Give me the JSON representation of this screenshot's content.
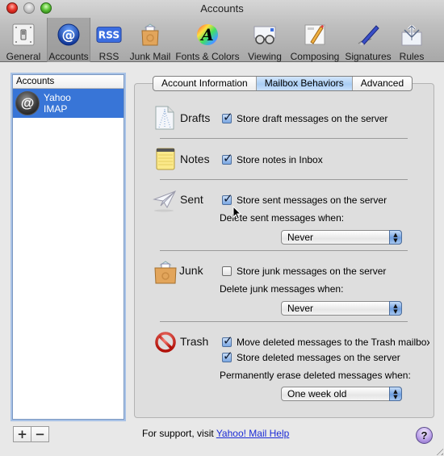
{
  "window": {
    "title": "Accounts"
  },
  "toolbar": {
    "items": [
      {
        "id": "general",
        "label": "General",
        "icon": "switch-icon",
        "selected": false
      },
      {
        "id": "accounts",
        "label": "Accounts",
        "icon": "at-sign-icon",
        "selected": true
      },
      {
        "id": "rss",
        "label": "RSS",
        "icon": "rss-icon",
        "selected": false
      },
      {
        "id": "junk",
        "label": "Junk Mail",
        "icon": "junk-bag-icon",
        "selected": false
      },
      {
        "id": "fonts",
        "label": "Fonts & Colors",
        "icon": "color-wheel-icon",
        "selected": false
      },
      {
        "id": "viewing",
        "label": "Viewing",
        "icon": "glasses-icon",
        "selected": false
      },
      {
        "id": "composing",
        "label": "Composing",
        "icon": "pencil-paper-icon",
        "selected": false
      },
      {
        "id": "signatures",
        "label": "Signatures",
        "icon": "pen-icon",
        "selected": false
      },
      {
        "id": "rules",
        "label": "Rules",
        "icon": "rules-arrows-icon",
        "selected": false
      }
    ],
    "rss_glyph": "RSS",
    "at_glyph": "@"
  },
  "accounts_list": {
    "header": "Accounts",
    "items": [
      {
        "name": "Yahoo",
        "type": "IMAP",
        "avatar_glyph": "@"
      }
    ],
    "add_label": "+",
    "remove_label": "−"
  },
  "tabs": [
    {
      "label": "Account Information",
      "active": false
    },
    {
      "label": "Mailbox Behaviors",
      "active": true
    },
    {
      "label": "Advanced",
      "active": false
    }
  ],
  "sections": {
    "drafts": {
      "title": "Drafts",
      "store_label": "Store draft messages on the server",
      "store_checked": true
    },
    "notes": {
      "title": "Notes",
      "store_label": "Store notes in Inbox",
      "store_checked": true
    },
    "sent": {
      "title": "Sent",
      "store_label": "Store sent messages on the server",
      "store_checked": true,
      "delete_label": "Delete sent messages when:",
      "delete_value": "Never"
    },
    "junk": {
      "title": "Junk",
      "store_label": "Store junk messages on the server",
      "store_checked": false,
      "delete_label": "Delete junk messages when:",
      "delete_value": "Never"
    },
    "trash": {
      "title": "Trash",
      "move_label": "Move deleted messages to the Trash mailbox",
      "move_checked": true,
      "store_label": "Store deleted messages on the server",
      "store_checked": true,
      "erase_label": "Permanently erase deleted messages when:",
      "erase_value": "One week old"
    }
  },
  "footer": {
    "support_prefix": "For support, visit ",
    "support_link": "Yahoo! Mail Help",
    "help_glyph": "?"
  },
  "popup_arrows": "▲▼"
}
